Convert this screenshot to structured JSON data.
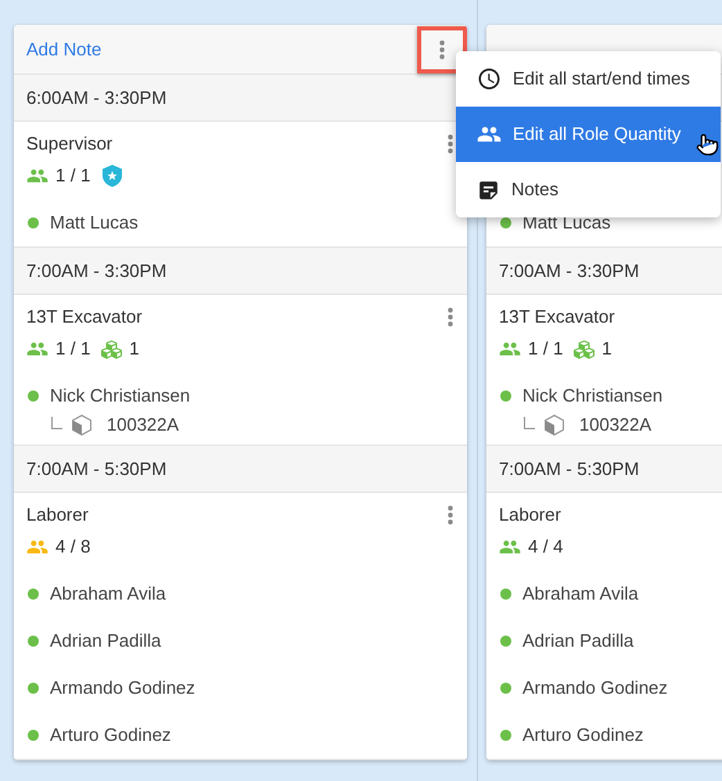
{
  "columns": [
    {
      "add_note": "Add Note",
      "header_button": true,
      "highlighted": true,
      "groups": [
        {
          "time": "6:00AM - 3:30PM",
          "roles": [
            {
              "title": "Supervisor",
              "actions": true,
              "count": "1 / 1",
              "color": "#6cc04a",
              "badges": [
                {
                  "kind": "shield"
                }
              ],
              "people": [
                {
                  "name": "Matt Lucas",
                  "color": "#6cc04a"
                }
              ]
            }
          ]
        },
        {
          "time": "7:00AM - 3:30PM",
          "roles": [
            {
              "title": "13T Excavator",
              "actions": true,
              "count": "1 / 1",
              "color": "#6cc04a",
              "badges": [
                {
                  "kind": "equipment",
                  "count": "1"
                }
              ],
              "people": [
                {
                  "name": "Nick Christiansen",
                  "color": "#6cc04a",
                  "equipment": [
                    {
                      "id": "100322A"
                    }
                  ]
                }
              ]
            }
          ]
        },
        {
          "time": "7:00AM - 5:30PM",
          "roles": [
            {
              "title": "Laborer",
              "actions": true,
              "count": "4 / 8",
              "color": "#f9b912",
              "people": [
                {
                  "name": "Abraham Avila",
                  "color": "#6cc04a"
                },
                {
                  "name": "Adrian Padilla",
                  "color": "#6cc04a"
                },
                {
                  "name": "Armando Godinez",
                  "color": "#6cc04a"
                },
                {
                  "name": "Arturo Godinez",
                  "color": "#6cc04a"
                }
              ]
            }
          ]
        }
      ]
    },
    {
      "groups": [
        {
          "roles": [
            {
              "people": [
                {
                  "name": "Matt Lucas",
                  "color": "#6cc04a"
                }
              ]
            }
          ]
        },
        {
          "time": "7:00AM - 3:30PM",
          "roles": [
            {
              "title": "13T Excavator",
              "count": "1 / 1",
              "color": "#6cc04a",
              "badges": [
                {
                  "kind": "equipment",
                  "count": "1"
                }
              ],
              "people": [
                {
                  "name": "Nick Christiansen",
                  "color": "#6cc04a",
                  "equipment": [
                    {
                      "id": "100322A"
                    }
                  ]
                }
              ]
            }
          ]
        },
        {
          "time": "7:00AM - 5:30PM",
          "roles": [
            {
              "title": "Laborer",
              "count": "4 / 4",
              "color": "#6cc04a",
              "people": [
                {
                  "name": "Abraham Avila",
                  "color": "#6cc04a"
                },
                {
                  "name": "Adrian Padilla",
                  "color": "#6cc04a"
                },
                {
                  "name": "Armando Godinez",
                  "color": "#6cc04a"
                },
                {
                  "name": "Arturo Godinez",
                  "color": "#6cc04a"
                }
              ]
            }
          ]
        }
      ]
    }
  ],
  "menu": {
    "items": [
      {
        "kind": "clock",
        "label": "Edit all start/end times",
        "selected": false
      },
      {
        "kind": "people",
        "label": "Edit all Role Quantity",
        "selected": true
      },
      {
        "kind": "notes",
        "label": "Notes",
        "selected": false
      }
    ]
  }
}
